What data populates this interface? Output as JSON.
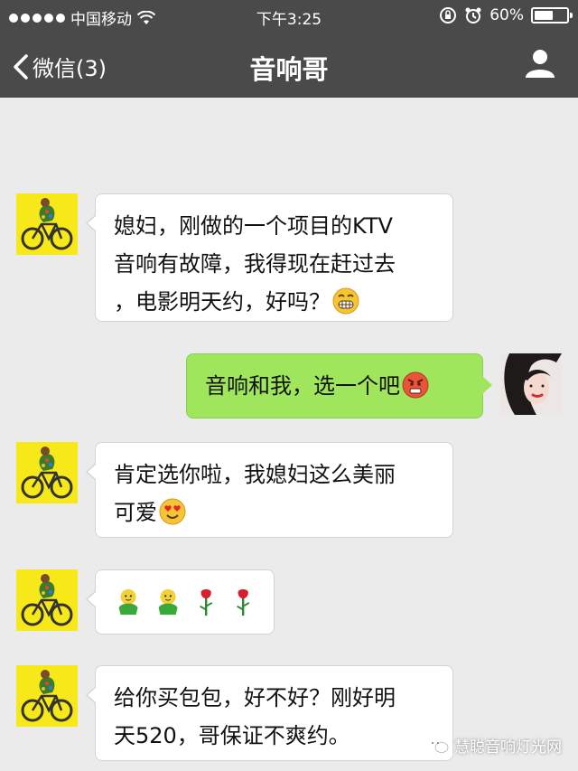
{
  "status_bar": {
    "carrier": "中国移动",
    "time": "下午3:25",
    "battery_percent": "60%",
    "battery_level": 0.6
  },
  "nav": {
    "back_label": "微信(3)",
    "title": "音响哥",
    "profile_icon": "person-icon"
  },
  "messages": [
    {
      "side": "left",
      "sender": "bike-avatar",
      "lines": [
        "媳妇，刚做的一个项目的KTV",
        "音响有故障，我得现在赶过去",
        "，电影明天约，好吗？"
      ],
      "emoji": "grin-emoji"
    },
    {
      "side": "right",
      "sender": "girl-avatar",
      "lines": [
        "音响和我，选一个吧"
      ],
      "emoji": "angry-emoji"
    },
    {
      "side": "left",
      "sender": "bike-avatar",
      "lines": [
        "肯定选你啦，我媳妇这么美丽",
        "可爱"
      ],
      "emoji": "heart-eyes-emoji"
    },
    {
      "side": "left",
      "sender": "bike-avatar",
      "stickers": [
        "green-figure-sticker",
        "green-figure-sticker",
        "rose-sticker",
        "rose-sticker"
      ]
    },
    {
      "side": "left",
      "sender": "bike-avatar",
      "lines": [
        "给你买包包，好不好？刚好明",
        "天520，哥保证不爽约。"
      ]
    }
  ],
  "watermark": "慧聪音响灯光网",
  "colors": {
    "bar_bg": "#4a4a4a",
    "chat_bg": "#ebebeb",
    "bubble_in": "#ffffff",
    "bubble_out": "#9fe65c",
    "avatar_bg": "#f7e81a"
  }
}
